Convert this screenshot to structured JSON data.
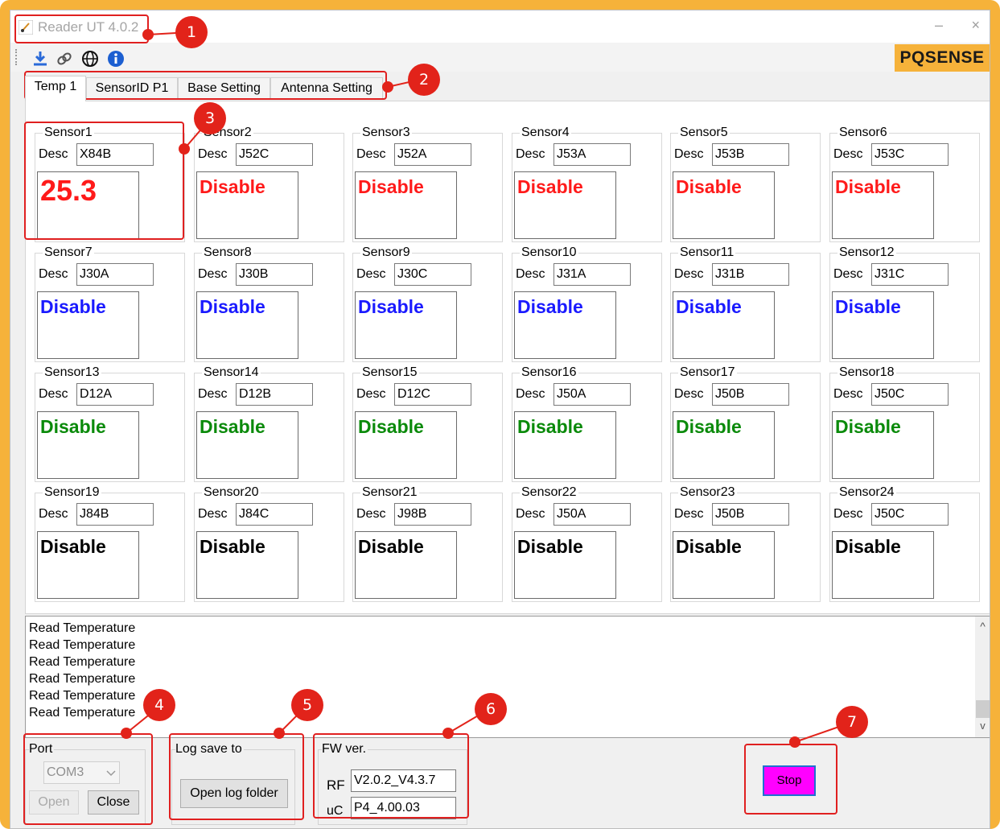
{
  "window": {
    "title": "Reader UT 4.0.2",
    "minimize_glyph": "–",
    "close_glyph": "×",
    "brand": "PQSENSE",
    "brand_color": "#f6b23a"
  },
  "toolbar": {
    "icons": [
      "download-icon",
      "link-icon",
      "globe-icon",
      "info-icon"
    ]
  },
  "tabs": [
    "Temp 1",
    "SensorID P1",
    "Base Setting",
    "Antenna Setting"
  ],
  "sensors": [
    {
      "name": "Sensor1",
      "desc": "X84B",
      "value": "25.3",
      "color": "#ff1a1a"
    },
    {
      "name": "Sensor2",
      "desc": "J52C",
      "value": "Disable",
      "color": "#ff1a1a"
    },
    {
      "name": "Sensor3",
      "desc": "J52A",
      "value": "Disable",
      "color": "#ff1a1a"
    },
    {
      "name": "Sensor4",
      "desc": "J53A",
      "value": "Disable",
      "color": "#ff1a1a"
    },
    {
      "name": "Sensor5",
      "desc": "J53B",
      "value": "Disable",
      "color": "#ff1a1a"
    },
    {
      "name": "Sensor6",
      "desc": "J53C",
      "value": "Disable",
      "color": "#ff1a1a"
    },
    {
      "name": "Sensor7",
      "desc": "J30A",
      "value": "Disable",
      "color": "#1a1aff"
    },
    {
      "name": "Sensor8",
      "desc": "J30B",
      "value": "Disable",
      "color": "#1a1aff"
    },
    {
      "name": "Sensor9",
      "desc": "J30C",
      "value": "Disable",
      "color": "#1a1aff"
    },
    {
      "name": "Sensor10",
      "desc": "J31A",
      "value": "Disable",
      "color": "#1a1aff"
    },
    {
      "name": "Sensor11",
      "desc": "J31B",
      "value": "Disable",
      "color": "#1a1aff"
    },
    {
      "name": "Sensor12",
      "desc": "J31C",
      "value": "Disable",
      "color": "#1a1aff"
    },
    {
      "name": "Sensor13",
      "desc": "D12A",
      "value": "Disable",
      "color": "#0a8a0a"
    },
    {
      "name": "Sensor14",
      "desc": "D12B",
      "value": "Disable",
      "color": "#0a8a0a"
    },
    {
      "name": "Sensor15",
      "desc": "D12C",
      "value": "Disable",
      "color": "#0a8a0a"
    },
    {
      "name": "Sensor16",
      "desc": "J50A",
      "value": "Disable",
      "color": "#0a8a0a"
    },
    {
      "name": "Sensor17",
      "desc": "J50B",
      "value": "Disable",
      "color": "#0a8a0a"
    },
    {
      "name": "Sensor18",
      "desc": "J50C",
      "value": "Disable",
      "color": "#0a8a0a"
    },
    {
      "name": "Sensor19",
      "desc": "J84B",
      "value": "Disable",
      "color": "#000000"
    },
    {
      "name": "Sensor20",
      "desc": "J84C",
      "value": "Disable",
      "color": "#000000"
    },
    {
      "name": "Sensor21",
      "desc": "J98B",
      "value": "Disable",
      "color": "#000000"
    },
    {
      "name": "Sensor22",
      "desc": "J50A",
      "value": "Disable",
      "color": "#000000"
    },
    {
      "name": "Sensor23",
      "desc": "J50B",
      "value": "Disable",
      "color": "#000000"
    },
    {
      "name": "Sensor24",
      "desc": "J50C",
      "value": "Disable",
      "color": "#000000"
    }
  ],
  "desc_label": "Desc",
  "log": {
    "lines": [
      "Read Temperature",
      "Read Temperature",
      "Read Temperature",
      "Read Temperature",
      "Read Temperature",
      "Read Temperature"
    ],
    "scroll_up": "^",
    "scroll_down": "v"
  },
  "port": {
    "label": "Port",
    "value": "COM3",
    "open": "Open",
    "close": "Close"
  },
  "logsave": {
    "label": "Log save to",
    "button": "Open log folder"
  },
  "fw": {
    "label": "FW ver.",
    "rf_label": "RF",
    "rf_value": "V2.0.2_V4.3.7",
    "uc_label": "uC",
    "uc_value": "P4_4.00.03"
  },
  "stop": {
    "label": "Stop",
    "color": "#ff00ff"
  },
  "annotations": [
    "1",
    "2",
    "3",
    "4",
    "5",
    "6",
    "7"
  ],
  "annotation_color": "#e2231a"
}
